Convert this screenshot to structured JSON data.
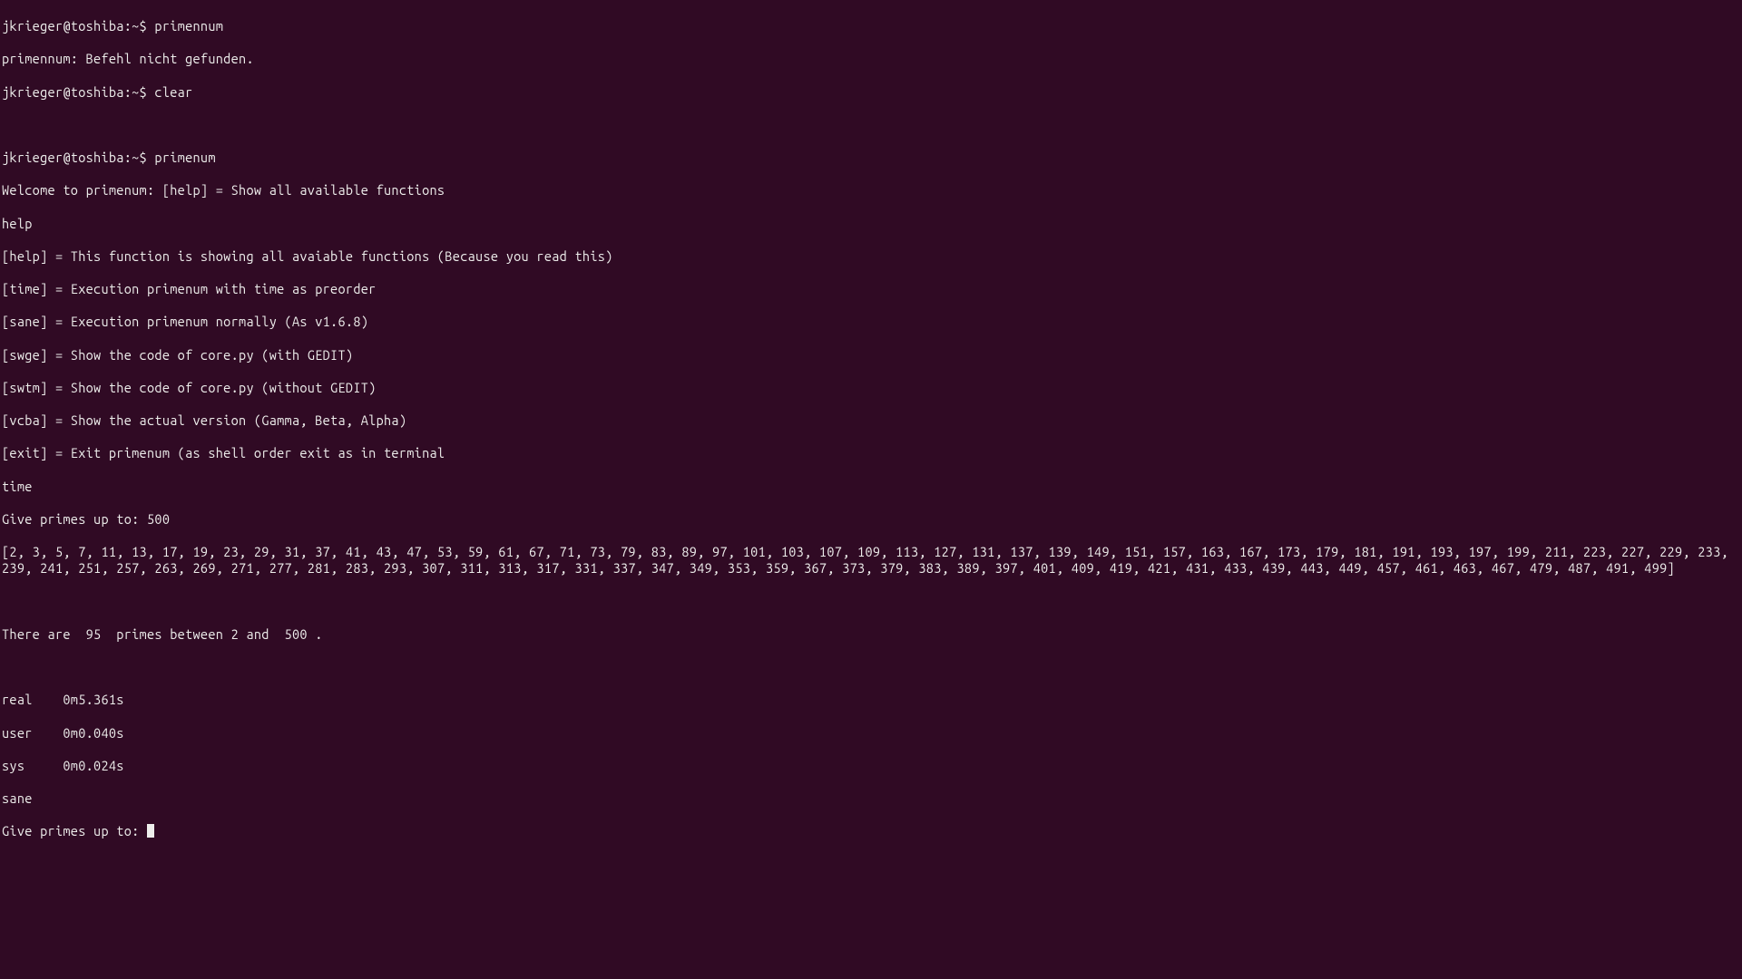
{
  "session": {
    "prompt1": "jkrieger@toshiba:~$ ",
    "cmd1": "primennum",
    "error1": "primennum: Befehl nicht gefunden.",
    "prompt2": "jkrieger@toshiba:~$ ",
    "cmd2": "clear",
    "prompt3": "jkrieger@toshiba:~$ ",
    "cmd3": "primenum",
    "welcome": "Welcome to primenum: [help] = Show all available functions",
    "input_help": "help",
    "help_line": "[help] = This function is showing all avaiable functions (Because you read this)",
    "time_line": "[time] = Execution primenum with time as preorder",
    "sane_line": "[sane] = Execution primenum normally (As v1.6.8)",
    "swge_line": "[swge] = Show the code of core.py (with GEDIT)",
    "swtm_line": "[swtm] = Show the code of core.py (without GEDIT)",
    "vcba_line": "[vcba] = Show the actual version (Gamma, Beta, Alpha)",
    "exit_line": "[exit] = Exit primenum (as shell order exit as in terminal",
    "input_time": "time",
    "give_primes_500": "Give primes up to: 500",
    "primes_list": "[2, 3, 5, 7, 11, 13, 17, 19, 23, 29, 31, 37, 41, 43, 47, 53, 59, 61, 67, 71, 73, 79, 83, 89, 97, 101, 103, 107, 109, 113, 127, 131, 137, 139, 149, 151, 157, 163, 167, 173, 179, 181, 191, 193, 197, 199, 211, 223, 227, 229, 233, 239, 241, 251, 257, 263, 269, 271, 277, 281, 283, 293, 307, 311, 313, 317, 331, 337, 347, 349, 353, 359, 367, 373, 379, 383, 389, 397, 401, 409, 419, 421, 431, 433, 439, 443, 449, 457, 461, 463, 467, 479, 487, 491, 499]",
    "count_line": "There are  95  primes between 2 and  500 .",
    "time_real": "real    0m5.361s",
    "time_user": "user    0m0.040s",
    "time_sys": "sys     0m0.024s",
    "input_sane": "sane",
    "give_primes_prompt": "Give primes up to: "
  }
}
